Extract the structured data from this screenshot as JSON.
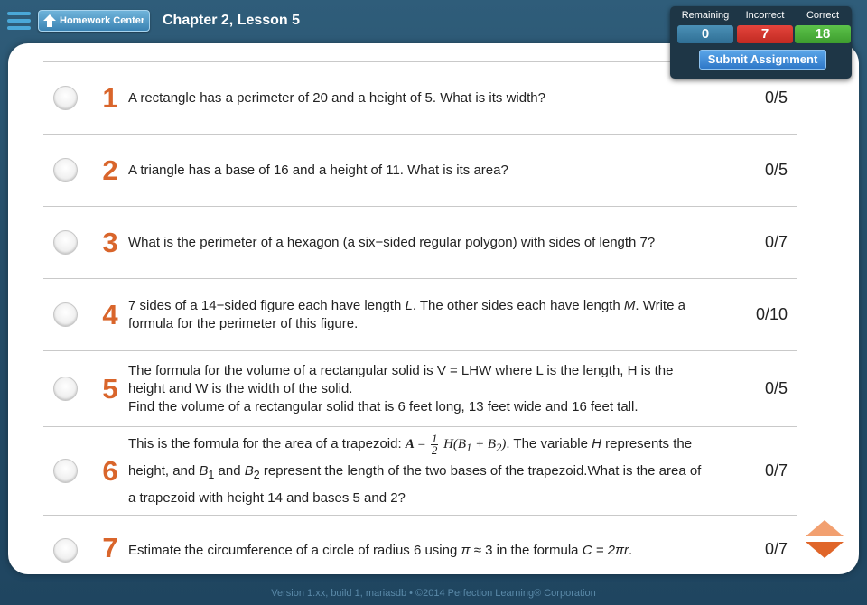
{
  "header": {
    "home_label": "Homework Center",
    "title": "Chapter 2, Lesson 5"
  },
  "scores": {
    "remaining_label": "Remaining",
    "remaining_value": "0",
    "incorrect_label": "Incorrect",
    "incorrect_value": "7",
    "correct_label": "Correct",
    "correct_value": "18",
    "submit_label": "Submit Assignment"
  },
  "questions": [
    {
      "num": "1",
      "text": "A rectangle has a perimeter of 20 and a height of 5. What is its width?",
      "score": "0/5"
    },
    {
      "num": "2",
      "text": "A triangle has a base of 16 and a height of 11. What is its area?",
      "score": "0/5"
    },
    {
      "num": "3",
      "text": "What is the perimeter of a hexagon (a six−sided regular polygon) with sides of length 7?",
      "score": "0/7"
    },
    {
      "num": "4",
      "text_a": "7 sides of a 14−sided figure each have length ",
      "var_a": "L",
      "text_b": ". The other sides each have length ",
      "var_b": "M",
      "text_c": ". Write a formula for the perimeter of this figure.",
      "score": "0/10"
    },
    {
      "num": "5",
      "line1": "The formula for the volume of a rectangular solid is V = LHW where L is the length, H is the height and W is the width of the solid.",
      "line2": "Find the volume of a rectangular solid that is 6 feet long, 13 feet wide and 16 feet tall.",
      "score": "0/5"
    },
    {
      "num": "6",
      "text_a": "This is the formula for the area of a trapezoid: ",
      "formula_a": "A",
      "formula_eq": " = ",
      "frac_num": "1",
      "frac_den": "2",
      "formula_b": " H(B",
      "sub1": "1",
      "formula_plus": " + B",
      "sub2": "2",
      "formula_c": ")",
      "text_b": ". The variable ",
      "var_h": "H",
      "text_c": " represents the height, and ",
      "var_b1": "B",
      "b1sub": "1",
      "text_d": " and ",
      "var_b2": "B",
      "b2sub": "2",
      "text_e": " represent the length of the two bases of the trapezoid.What is the area of a trapezoid with height 14 and bases 5 and 2?",
      "score": "0/7"
    },
    {
      "num": "7",
      "text_a": "Estimate the circumference of a circle of radius 6 using ",
      "pi": "π",
      "text_b": " ≈ 3 in the formula ",
      "formula": "C = 2πr",
      "text_c": ".",
      "score": "0/7"
    }
  ],
  "footer": "Version 1.xx, build 1, mariasdb  •  ©2014 Perfection Learning® Corporation",
  "colors": {
    "number": "#d9652b",
    "incorrect": "#e4443c",
    "correct": "#5cc24a",
    "remaining": "#3f83a9",
    "arrow_up": "#f2a070",
    "arrow_down": "#e0662a"
  }
}
